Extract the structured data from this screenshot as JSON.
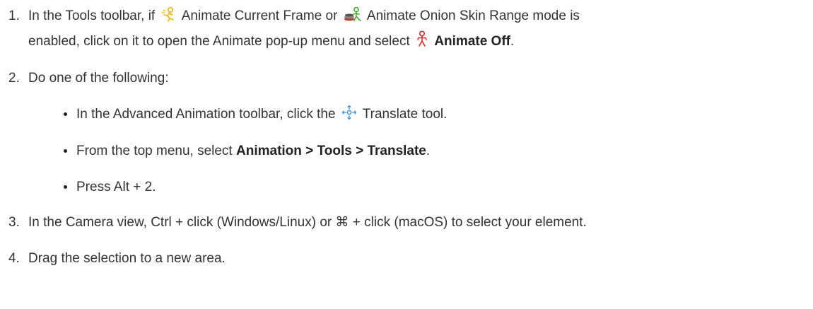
{
  "steps": [
    {
      "number": "1.",
      "line1_a": "In the Tools toolbar, if ",
      "animate_current_label": " Animate Current Frame or ",
      "animate_onion_label": " Animate Onion Skin Range mode is",
      "line2_a": "enabled, click on it to open the Animate pop-up menu and select ",
      "animate_off_label": "Animate Off",
      "line2_end": "."
    },
    {
      "number": "2.",
      "text": "Do one of the following:",
      "sub": [
        {
          "text_a": "In the Advanced Animation toolbar, click the ",
          "text_b": " Translate tool."
        },
        {
          "text_a": "From the top menu, select ",
          "bold": "Animation > Tools > Translate",
          "text_b": "."
        },
        {
          "text": "Press Alt + 2."
        }
      ]
    },
    {
      "number": "3.",
      "text": "In the Camera view, Ctrl + click (Windows/Linux) or ⌘ + click (macOS) to select your element."
    },
    {
      "number": "4.",
      "text": "Drag the selection to a new area."
    }
  ],
  "icons": {
    "animate_current": "animate-current-frame-icon",
    "animate_onion": "animate-onion-skin-range-icon",
    "animate_off": "animate-off-icon",
    "translate": "translate-tool-icon"
  },
  "colors": {
    "text": "#333333",
    "animate_current": "#f2b400",
    "animate_onion": "#3cae2a",
    "animate_off": "#d7262c"
  }
}
